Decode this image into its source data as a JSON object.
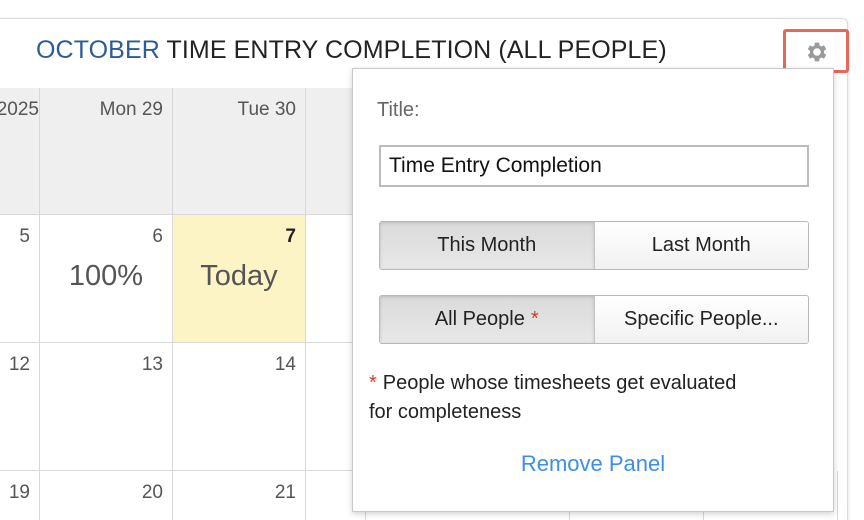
{
  "panel": {
    "title_month": "OCTOBER",
    "title_rest": "TIME ENTRY COMPLETION (ALL PEOPLE)",
    "settings_icon": "gear-icon"
  },
  "calendar": {
    "header": [
      "2025",
      "Mon 29",
      "Tue 30"
    ],
    "row1": {
      "days": [
        "5",
        "6",
        "7"
      ],
      "values": [
        "",
        "100%",
        "Today"
      ]
    },
    "row2": {
      "days": [
        "12",
        "13",
        "14"
      ]
    },
    "row3": {
      "days": [
        "19",
        "20",
        "21"
      ]
    }
  },
  "settings": {
    "title_label": "Title:",
    "title_value": "Time Entry Completion",
    "range_options": [
      "This Month",
      "Last Month"
    ],
    "range_selected": "This Month",
    "people_options": [
      "All People",
      "Specific People..."
    ],
    "people_selected": "All People",
    "required_marker": "*",
    "note": "People whose timesheets get evaluated for completeness",
    "remove_label": "Remove Panel"
  },
  "colors": {
    "accent_blue": "#2c5c98",
    "link_blue": "#3d8ee6",
    "highlight_red": "#e4685b",
    "today_yellow": "#fdf4c6"
  }
}
